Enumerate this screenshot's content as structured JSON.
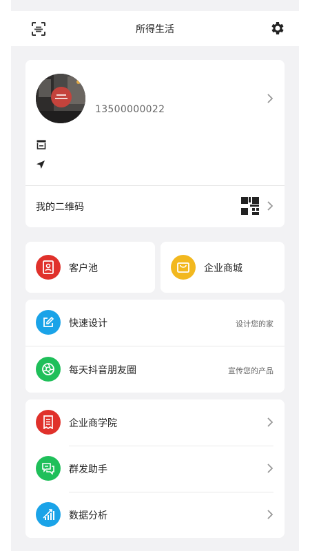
{
  "header": {
    "title": "所得生活",
    "scan_icon": "scan-icon",
    "settings_icon": "gear-icon"
  },
  "profile": {
    "phone": "13500000022",
    "avatar_icon": "avatar-image",
    "store_icon": "store-icon",
    "location_icon": "navigation-arrow-icon",
    "qr_label": "我的二维码",
    "qr_icon": "qr-code-icon"
  },
  "tiles": [
    {
      "label": "客户池",
      "icon": "contact-card-icon",
      "color": "#e0312b"
    },
    {
      "label": "企业商城",
      "icon": "shopping-bag-icon",
      "color": "#f2b81f"
    }
  ],
  "quick_list": [
    {
      "label": "快速设计",
      "hint": "设计您的家",
      "icon": "edit-icon",
      "color": "#1aa3e8"
    },
    {
      "label": "每天抖音朋友圈",
      "hint": "宣传您的产品",
      "icon": "aperture-icon",
      "color": "#1fbf5a"
    }
  ],
  "menu_list": [
    {
      "label": "企业商学院",
      "icon": "receipt-icon",
      "color": "#e0312b"
    },
    {
      "label": "群发助手",
      "icon": "chat-bubbles-icon",
      "color": "#1fbf5a"
    },
    {
      "label": "数据分析",
      "icon": "chart-icon",
      "color": "#1aa3e8"
    }
  ]
}
